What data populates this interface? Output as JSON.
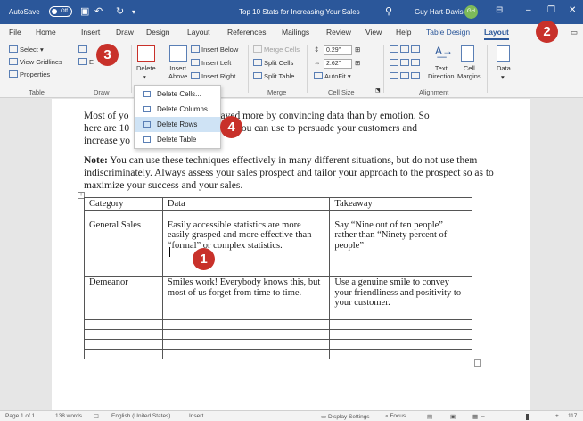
{
  "titlebar": {
    "autosave_label": "AutoSave",
    "autosave_state": "Off",
    "undo_icon": "undo-icon",
    "title": "Top 10 Stats for Increasing Your Sales",
    "user_name": "Guy Hart-Davis",
    "user_initials": "GH",
    "bg_color": "#2b579a"
  },
  "tabs": [
    {
      "label": "File"
    },
    {
      "label": "Home"
    },
    {
      "label": "Insert"
    },
    {
      "label": "Draw"
    },
    {
      "label": "Design"
    },
    {
      "label": "Layout"
    },
    {
      "label": "References"
    },
    {
      "label": "Mailings"
    },
    {
      "label": "Review"
    },
    {
      "label": "View"
    },
    {
      "label": "Help"
    },
    {
      "label": "Table Design"
    },
    {
      "label": "Layout",
      "active": true
    }
  ],
  "ribbon": {
    "table_group": {
      "select": "Select",
      "gridlines": "View Gridlines",
      "properties": "Properties",
      "label": "Table"
    },
    "draw_group": {
      "label": "Draw"
    },
    "rows_group": {
      "delete": "Delete",
      "insert_above": "Insert\nAbove",
      "insert_below": "Insert Below",
      "insert_left": "Insert Left",
      "insert_right": "Insert Right"
    },
    "merge_group": {
      "merge": "Merge Cells",
      "split_cells": "Split Cells",
      "split_table": "Split Table",
      "label": "Merge"
    },
    "cellsize_group": {
      "height": "0.29\"",
      "width": "2.62\"",
      "autofit": "AutoFit",
      "label": "Cell Size"
    },
    "alignment_group": {
      "text_direction": "Text\nDirection",
      "cell_margins": "Cell\nMargins",
      "label": "Alignment"
    },
    "data_group": {
      "label": "Data"
    }
  },
  "dropdown": {
    "items": [
      {
        "label": "Delete Cells...",
        "icon": "delete-cells-icon"
      },
      {
        "label": "Delete Columns",
        "icon": "delete-columns-icon"
      },
      {
        "label": "Delete Rows",
        "icon": "delete-rows-icon",
        "highlighted": true
      },
      {
        "label": "Delete Table",
        "icon": "delete-table-icon"
      }
    ]
  },
  "document": {
    "para1_a": "Most of yo",
    "para1_b": "ayed more by convincing data than by emotion. So",
    "para1_line2_a": "here are 10",
    "para1_line2_b": "iniques you can use to persuade your customers and",
    "para1_line3": "increase yo",
    "para2_bold": "Note:",
    "para2": " You can use these techniques effectively in many different situations, but do not use them indiscriminately. Always assess your sales prospect and tailor your approach to the prospect so as to maximize your success and your sales.",
    "table": {
      "headers": [
        "Category",
        "Data",
        "Takeaway"
      ],
      "rows": [
        [
          "General Sales",
          "Easily accessible statistics are more easily grasped and more effective than “formal” or complex statistics.",
          "Say “Nine out of ten people” rather than “Ninety percent of people”"
        ],
        [
          "",
          "",
          ""
        ],
        [
          "Demeanor",
          "Smiles work! Everybody knows this, but most of us forget from time to time.",
          "Use a genuine smile to convey your friendliness and positivity to your customer."
        ],
        [
          "",
          "",
          ""
        ],
        [
          "",
          "",
          ""
        ],
        [
          "",
          "",
          ""
        ],
        [
          "",
          "",
          ""
        ],
        [
          "",
          "",
          ""
        ]
      ]
    }
  },
  "callouts": [
    "1",
    "2",
    "3",
    "4"
  ],
  "callout_color": "#c8312a",
  "statusbar": {
    "page": "Page 1 of 1",
    "words": "138 words",
    "language": "English (United States)",
    "mode": "Insert",
    "display_settings": "Display Settings",
    "focus": "Focus",
    "zoom": "117"
  }
}
